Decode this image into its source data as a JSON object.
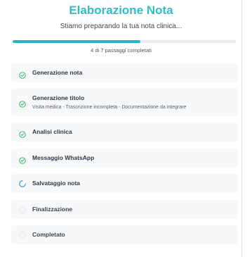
{
  "header": {
    "title": "Elaborazione Nota",
    "subtitle": "Stiamo preparando la tua nota clinica..."
  },
  "progress": {
    "completed": 4,
    "total": 7,
    "fraction": 0.571,
    "label": "4 di 7 passaggi completati"
  },
  "colors": {
    "accent": "#2bbfc7",
    "progress_fill": "#22b8c6",
    "done": "#2fb86a",
    "loading": "#2f8fd8",
    "step_bg": "#f7f8f9"
  },
  "steps": [
    {
      "label": "Generazione nota",
      "status": "done",
      "icon": "check-circle-icon"
    },
    {
      "label": "Generazione titolo",
      "status": "done",
      "icon": "check-circle-icon",
      "detail": "Visita medica - Trascrizione incompleta - Documentazione da integrare"
    },
    {
      "label": "Analisi clinica",
      "status": "done",
      "icon": "check-circle-icon"
    },
    {
      "label": "Messaggio WhatsApp",
      "status": "done",
      "icon": "check-circle-icon"
    },
    {
      "label": "Salvataggio nota",
      "status": "in-progress",
      "icon": "spinner-icon"
    },
    {
      "label": "Finalizzazione",
      "status": "pending",
      "icon": "empty-circle-icon"
    },
    {
      "label": "Completato",
      "status": "pending",
      "icon": "empty-circle-icon"
    }
  ]
}
